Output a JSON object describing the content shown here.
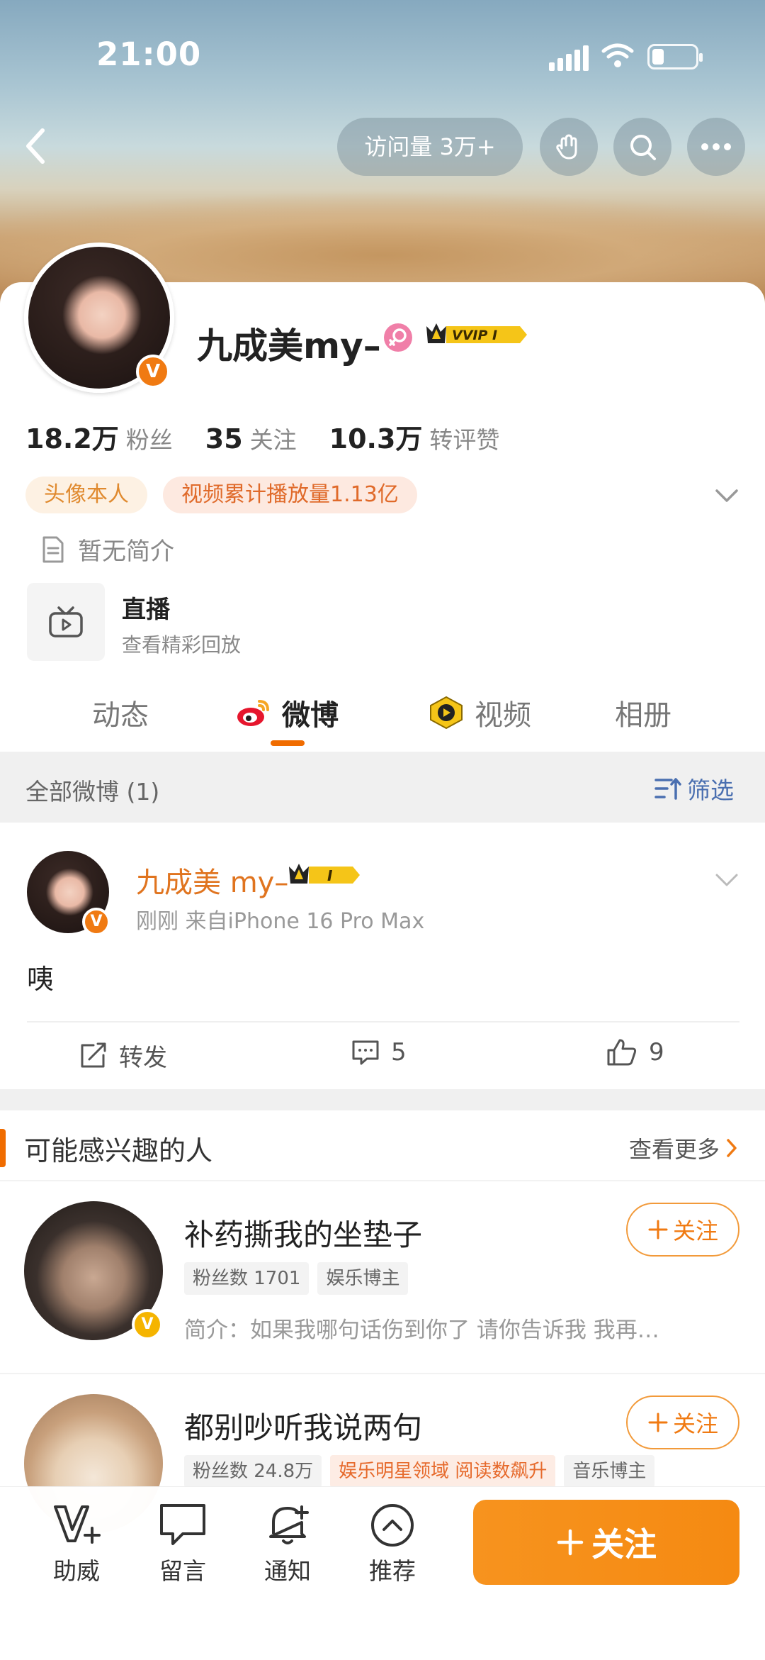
{
  "status_bar": {
    "time": "21:00"
  },
  "header": {
    "visits_label": "访问量 3万+"
  },
  "profile": {
    "name": "九成美my–",
    "vip_badge": "VVIP I",
    "verified_badge": "V",
    "stats": [
      {
        "value": "18.2万",
        "label": "粉丝"
      },
      {
        "value": "35",
        "label": "关注"
      },
      {
        "value": "10.3万",
        "label": "转评赞"
      }
    ],
    "tags": [
      "头像本人",
      "视频累计播放量1.13亿"
    ],
    "intro": "暂无简介",
    "live": {
      "title": "直播",
      "subtitle": "查看精彩回放"
    }
  },
  "tabs": [
    {
      "label": "动态",
      "active": false
    },
    {
      "label": "微博",
      "active": true
    },
    {
      "label": "视频",
      "active": false
    },
    {
      "label": "相册",
      "active": false
    }
  ],
  "feed": {
    "filter_label": "全部微博 (1)",
    "filter_button": "筛选",
    "post": {
      "author": "九成美 my–",
      "badge": "I",
      "meta": "刚刚  来自iPhone 16 Pro Max",
      "body": "咦",
      "actions": {
        "repost": "转发",
        "comments": "5",
        "likes": "9"
      }
    }
  },
  "recommend": {
    "title": "可能感兴趣的人",
    "more": "查看更多",
    "people": [
      {
        "name": "补药撕我的坐垫子",
        "tags": [
          "粉丝数 1701",
          "娱乐博主"
        ],
        "intro": "简介：如果我哪句话伤到你了 请你告诉我 我再…",
        "follow": "关注"
      },
      {
        "name": "都别吵听我说两句",
        "tags": [
          "粉丝数 24.8万",
          "娱乐明星领域 阅读数飙升",
          "音乐博主"
        ],
        "follow": "关注"
      }
    ]
  },
  "bottom_bar": {
    "items": [
      "助威",
      "留言",
      "通知",
      "推荐"
    ],
    "follow_label": "关注"
  },
  "colors": {
    "accent": "#F7931E",
    "link": "#4A6FB0",
    "name_orange": "#E0741F"
  }
}
